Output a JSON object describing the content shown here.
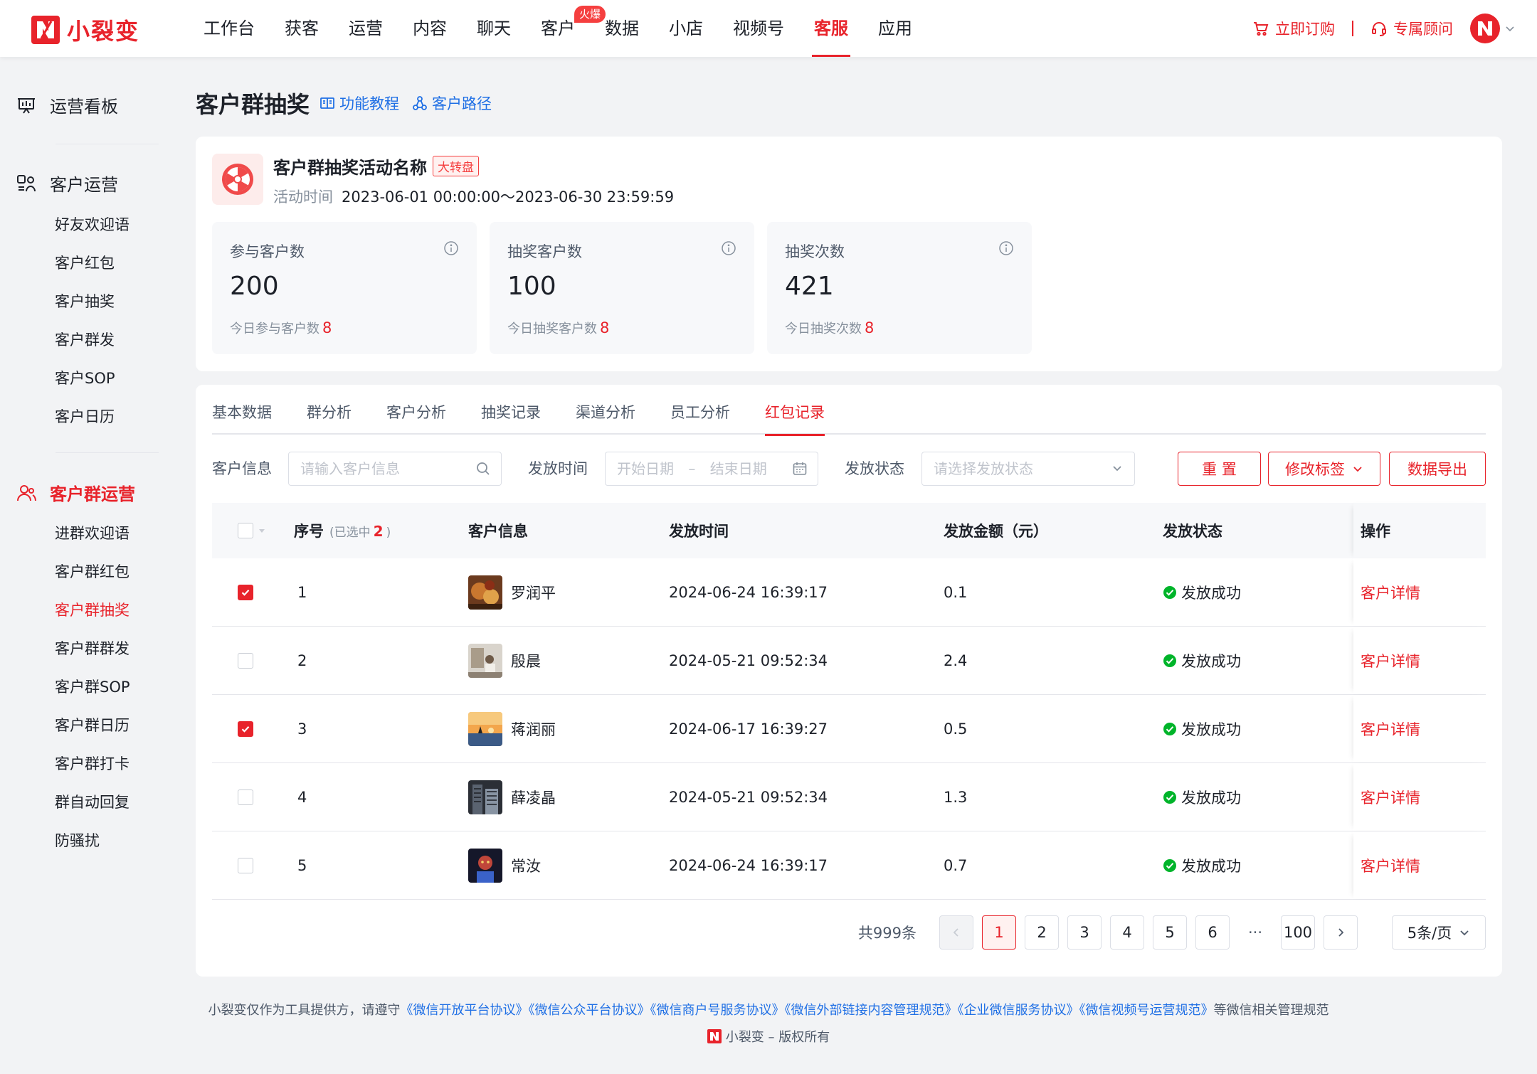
{
  "brand": {
    "name": "小裂变"
  },
  "nav": {
    "items": [
      "工作台",
      "获客",
      "运营",
      "内容",
      "聊天",
      "客户",
      "数据",
      "小店",
      "视频号",
      "客服",
      "应用"
    ],
    "hot_badge": "火爆",
    "active": "客服",
    "buy": "立即订购",
    "advisor": "专属顾问"
  },
  "sidebar": {
    "board": "运营看板",
    "cust_ops": "客户运营",
    "cust_items": [
      "好友欢迎语",
      "客户红包",
      "客户抽奖",
      "客户群发",
      "客户SOP",
      "客户日历"
    ],
    "group_ops": "客户群运营",
    "group_items": [
      "进群欢迎语",
      "客户群红包",
      "客户群抽奖",
      "客户群群发",
      "客户群SOP",
      "客户群日历",
      "客户群打卡",
      "群自动回复",
      "防骚扰"
    ],
    "active_item": "客户群抽奖"
  },
  "page": {
    "title": "客户群抽奖",
    "tutorial": "功能教程",
    "path": "客户路径"
  },
  "activity": {
    "name": "客户群抽奖活动名称",
    "tag": "大转盘",
    "time_label": "活动时间",
    "time_value": "2023-06-01 00:00:00～2023-06-30 23:59:59"
  },
  "stats": [
    {
      "label": "参与客户数",
      "value": "200",
      "sub": "今日参与客户数",
      "today": "8"
    },
    {
      "label": "抽奖客户数",
      "value": "100",
      "sub": "今日抽奖客户数",
      "today": "8"
    },
    {
      "label": "抽奖次数",
      "value": "421",
      "sub": "今日抽奖次数",
      "today": "8"
    }
  ],
  "tabs": [
    "基本数据",
    "群分析",
    "客户分析",
    "抽奖记录",
    "渠道分析",
    "员工分析",
    "红包记录"
  ],
  "active_tab": "红包记录",
  "filters": {
    "info_label": "客户信息",
    "info_placeholder": "请输入客户信息",
    "time_label": "发放时间",
    "start_placeholder": "开始日期",
    "range_sep": "–",
    "end_placeholder": "结束日期",
    "status_label": "发放状态",
    "status_placeholder": "请选择发放状态",
    "reset": "重 置",
    "edit_tag": "修改标签",
    "export": "数据导出"
  },
  "table": {
    "headers": {
      "no": "序号",
      "selected_prefix": "(已选中",
      "selected_count": "2",
      "selected_suffix": ")",
      "info": "客户信息",
      "time": "发放时间",
      "amount": "发放金额（元）",
      "status": "发放状态",
      "op": "操作"
    },
    "rows": [
      {
        "checked": true,
        "no": "1",
        "name": "罗润平",
        "time": "2024-06-24 16:39:17",
        "amount": "0.1",
        "status": "发放成功",
        "op": "客户详情",
        "avatar": "food"
      },
      {
        "checked": false,
        "no": "2",
        "name": "殷晨",
        "time": "2024-05-21 09:52:34",
        "amount": "2.4",
        "status": "发放成功",
        "op": "客户详情",
        "avatar": "room"
      },
      {
        "checked": true,
        "no": "3",
        "name": "蒋润丽",
        "time": "2024-06-17 16:39:27",
        "amount": "0.5",
        "status": "发放成功",
        "op": "客户详情",
        "avatar": "sunset"
      },
      {
        "checked": false,
        "no": "4",
        "name": "薛凌晶",
        "time": "2024-05-21 09:52:34",
        "amount": "1.3",
        "status": "发放成功",
        "op": "客户详情",
        "avatar": "building"
      },
      {
        "checked": false,
        "no": "5",
        "name": "常汝",
        "time": "2024-06-24 16:39:17",
        "amount": "0.7",
        "status": "发放成功",
        "op": "客户详情",
        "avatar": "portrait"
      }
    ]
  },
  "pagination": {
    "total": "共999条",
    "pages": [
      "1",
      "2",
      "3",
      "4",
      "5",
      "6"
    ],
    "dots": "···",
    "last": "100",
    "current": "1",
    "page_size": "5条/页"
  },
  "footer": {
    "prefix": "小裂变仅作为工具提供方，请遵守",
    "agreements": [
      "《微信开放平台协议》",
      "《微信公众平台协议》",
      "《微信商户号服务协议》",
      "《微信外部链接内容管理规范》",
      "《企业微信服务协议》",
      "《微信视频号运营规范》"
    ],
    "suffix": "等微信相关管理规范",
    "copyright": "小裂变 – 版权所有"
  },
  "colors": {
    "brand": "#e8232b",
    "link": "#1f6fe5",
    "success": "#00b42a"
  }
}
